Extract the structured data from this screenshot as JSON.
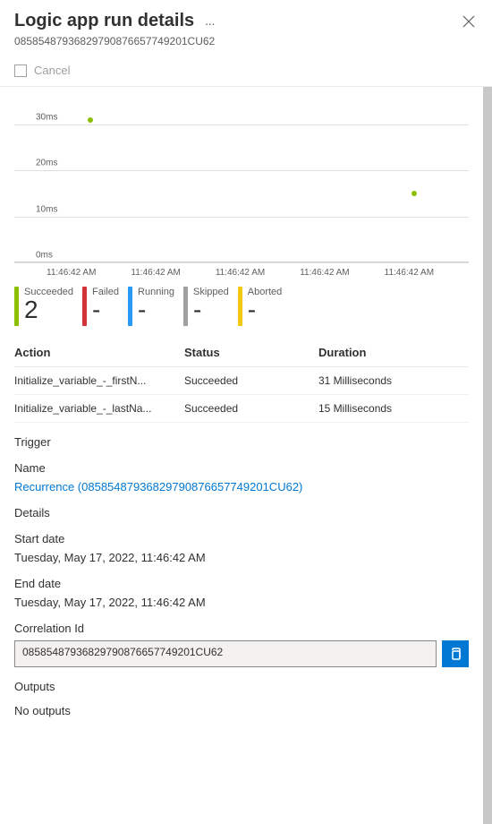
{
  "header": {
    "title": "Logic app run details",
    "run_id": "08585487936829790876657749201CU62"
  },
  "toolbar": {
    "cancel_label": "Cancel"
  },
  "chart_data": {
    "type": "scatter",
    "ylabel": "",
    "ylim": [
      0,
      35
    ],
    "yticks": [
      "0ms",
      "10ms",
      "20ms",
      "30ms"
    ],
    "xticks": [
      "11:46:42 AM",
      "11:46:42 AM",
      "11:46:42 AM",
      "11:46:42 AM",
      "11:46:42 AM"
    ],
    "series": [
      {
        "name": "Succeeded",
        "color": "#8cbf00",
        "points": [
          {
            "x_index": 0.25,
            "y": 31
          },
          {
            "x_index": 3.4,
            "y": 15
          }
        ]
      }
    ]
  },
  "status_counts": [
    {
      "label": "Succeeded",
      "count": "2",
      "color": "#8cbf00"
    },
    {
      "label": "Failed",
      "count": "-",
      "color": "#d13438"
    },
    {
      "label": "Running",
      "count": "-",
      "color": "#2899f5"
    },
    {
      "label": "Skipped",
      "count": "-",
      "color": "#a19f9d"
    },
    {
      "label": "Aborted",
      "count": "-",
      "color": "#f2c811"
    }
  ],
  "actions_table": {
    "headers": {
      "action": "Action",
      "status": "Status",
      "duration": "Duration"
    },
    "rows": [
      {
        "action": "Initialize_variable_-_firstN...",
        "status": "Succeeded",
        "duration": "31 Milliseconds"
      },
      {
        "action": "Initialize_variable_-_lastNa...",
        "status": "Succeeded",
        "duration": "15 Milliseconds"
      }
    ]
  },
  "trigger": {
    "section_label": "Trigger",
    "name_label": "Name",
    "name_link": "Recurrence (08585487936829790876657749201CU62)"
  },
  "details": {
    "section_label": "Details",
    "start_label": "Start date",
    "start_value": "Tuesday, May 17, 2022, 11:46:42 AM",
    "end_label": "End date",
    "end_value": "Tuesday, May 17, 2022, 11:46:42 AM",
    "corr_label": "Correlation Id",
    "corr_value": "08585487936829790876657749201CU62"
  },
  "outputs": {
    "section_label": "Outputs",
    "value": "No outputs"
  }
}
